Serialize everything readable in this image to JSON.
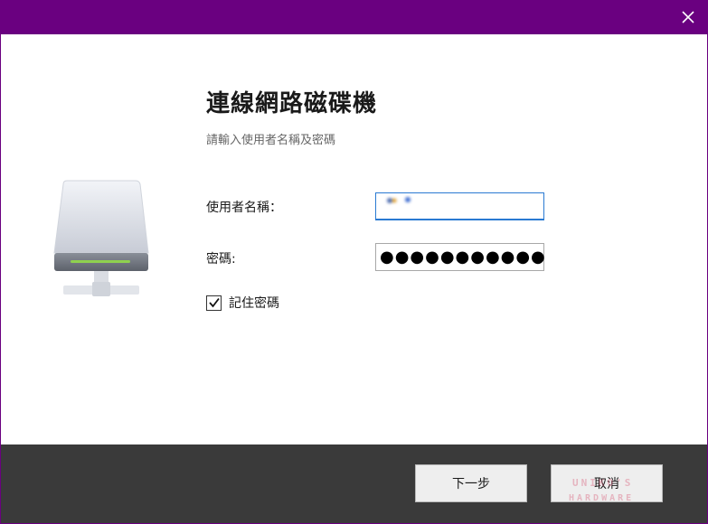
{
  "window": {
    "close_glyph": "✕"
  },
  "content": {
    "title": "連線網路磁碟機",
    "subtitle": "請輸入使用者名稱及密碼"
  },
  "form": {
    "username_label": "使用者名稱：",
    "username_value": "",
    "password_label": "密碼:",
    "password_value": "●●●●●●●●●●●",
    "remember_label": "記住密碼",
    "remember_checked": true
  },
  "footer": {
    "next_label": "下一步",
    "cancel_label": "取消"
  },
  "watermark": {
    "top_text": "UNIKO'S",
    "bottom_text": "HARDWARE"
  },
  "colors": {
    "titlebar": "#6a0080",
    "footer": "#3a3a3a",
    "input_focus": "#2a7ad2",
    "drive_indicator": "#8fd14f"
  },
  "icons": {
    "close": "close-icon",
    "drive": "network-drive-icon",
    "check": "checkmark-icon"
  }
}
